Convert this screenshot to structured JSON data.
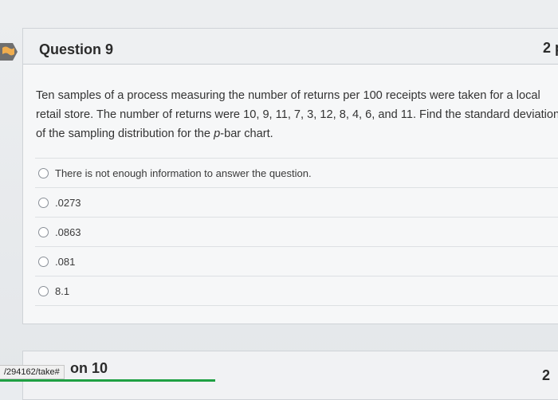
{
  "question": {
    "title": "Question 9",
    "points": "2 p",
    "text_part1": "Ten samples of a process measuring the number of returns per 100 receipts were taken for a local retail store. The number of returns were 10, 9, 11, 7, 3, 12, 8, 4, 6, and 11. Find the standard deviation of the sampling distribution for the ",
    "text_italic": "p",
    "text_part2": "-bar chart.",
    "answers": [
      {
        "label": "There is not enough information to answer the question."
      },
      {
        "label": ".0273"
      },
      {
        "label": ".0863"
      },
      {
        "label": ".081"
      },
      {
        "label": "8.1"
      }
    ]
  },
  "next_question": {
    "title": "on 10",
    "points": "2"
  },
  "status_url": "/294162/take#",
  "colors": {
    "flag": "#f0ad4e",
    "focus": "#1fa043"
  },
  "icons": {
    "flag": "flag-icon",
    "radio": "radio-button-icon"
  }
}
